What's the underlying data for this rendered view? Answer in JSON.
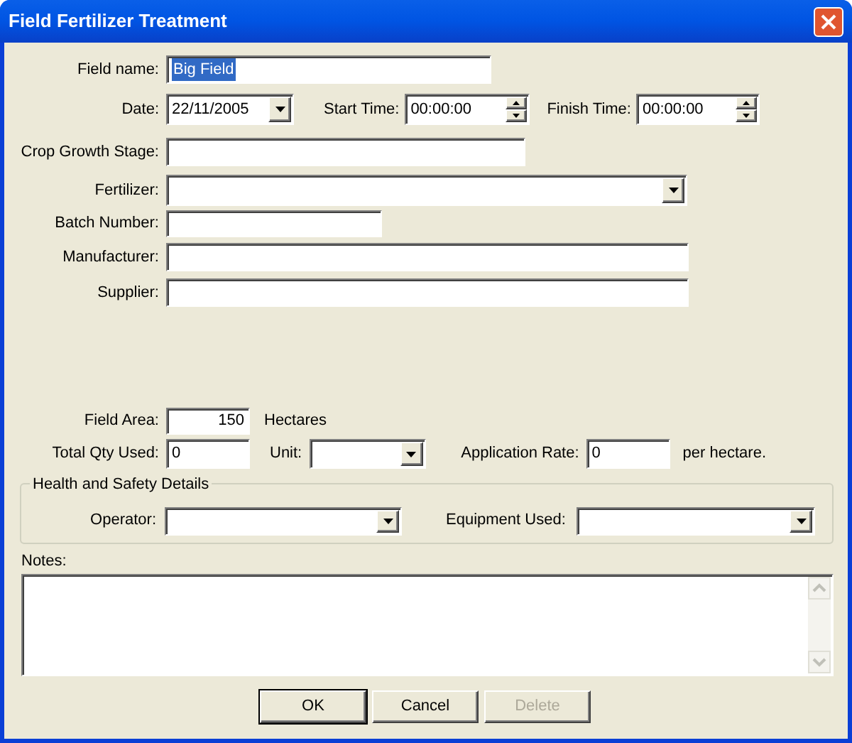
{
  "window": {
    "title": "Field Fertilizer Treatment"
  },
  "field_name": {
    "label": "Field name:",
    "value": "Big Field",
    "text_selected": true
  },
  "date": {
    "label": "Date:",
    "value": "22/11/2005"
  },
  "start_time": {
    "label": "Start Time:",
    "value": "00:00:00"
  },
  "finish_time": {
    "label": "Finish Time:",
    "value": "00:00:00"
  },
  "crop_growth_stage": {
    "label": "Crop Growth Stage:"
  },
  "fertilizer": {
    "label": "Fertilizer:"
  },
  "batch_number": {
    "label": "Batch Number:"
  },
  "manufacturer": {
    "label": "Manufacturer:"
  },
  "supplier": {
    "label": "Supplier:"
  },
  "field_area": {
    "label": "Field Area:",
    "value": "150",
    "unit": "Hectares"
  },
  "total_qty_used": {
    "label": "Total Qty Used:",
    "value": "0"
  },
  "unit": {
    "label": "Unit:"
  },
  "application_rate": {
    "label": "Application Rate:",
    "value": "0",
    "suffix": "per hectare."
  },
  "health_and_safety": {
    "legend": "Health and Safety Details",
    "operator": {
      "label": "Operator:"
    },
    "equipment_used": {
      "label": "Equipment Used:"
    }
  },
  "notes": {
    "label": "Notes:"
  },
  "buttons": [
    {
      "label": "OK",
      "default": true,
      "disabled": false
    },
    {
      "label": "Cancel",
      "default": false,
      "disabled": false
    },
    {
      "label": "Delete",
      "default": false,
      "disabled": true
    }
  ]
}
